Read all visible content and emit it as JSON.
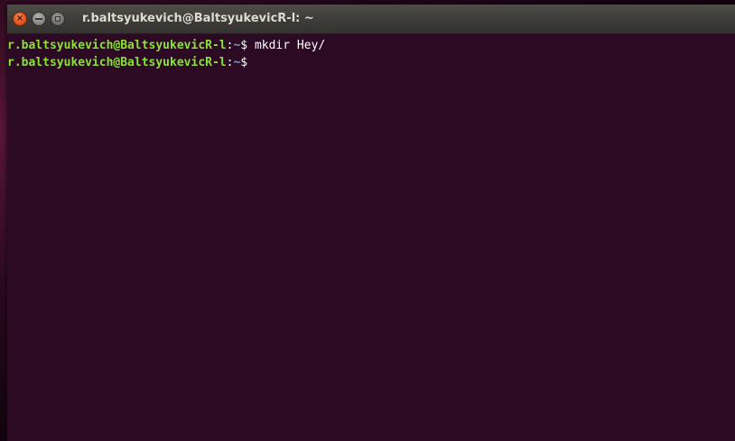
{
  "window": {
    "title": "r.baltsyukevich@BaltsyukevicR-l: ~",
    "close_glyph": "×",
    "colors": {
      "terminal_bg": "#2c0a24",
      "prompt_user": "#8ae234",
      "prompt_path": "#729fcf",
      "close_button": "#e95420"
    }
  },
  "terminal": {
    "lines": [
      {
        "user_host": "r.baltsyukevich@BaltsyukevicR-l",
        "colon": ":",
        "path": "~",
        "dollar": "$",
        "command": " mkdir Hey/"
      },
      {
        "user_host": "r.baltsyukevich@BaltsyukevicR-l",
        "colon": ":",
        "path": "~",
        "dollar": "$",
        "command": ""
      }
    ]
  }
}
